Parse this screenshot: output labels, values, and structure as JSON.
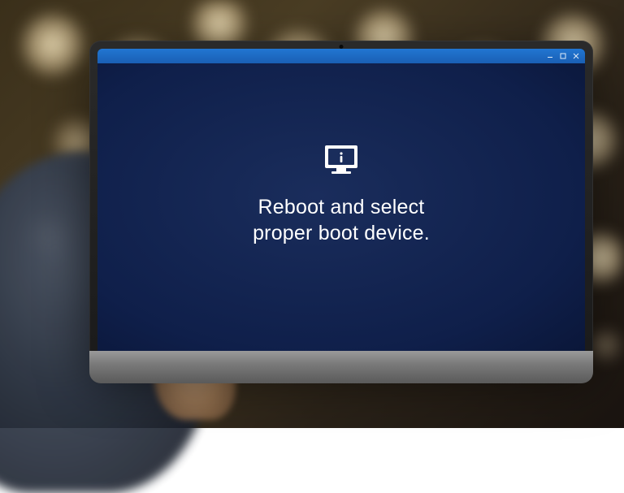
{
  "titlebar": {
    "left_text": "",
    "minimize_icon": "minimize-icon",
    "maximize_icon": "maximize-icon",
    "close_icon": "close-icon"
  },
  "error": {
    "icon": "monitor-alert-icon",
    "message_line1": "Reboot and select",
    "message_line2": "proper boot device."
  },
  "colors": {
    "titlebar_bg": "#1e6ac4",
    "screen_bg": "#0f1f4a",
    "text": "#ffffff"
  }
}
